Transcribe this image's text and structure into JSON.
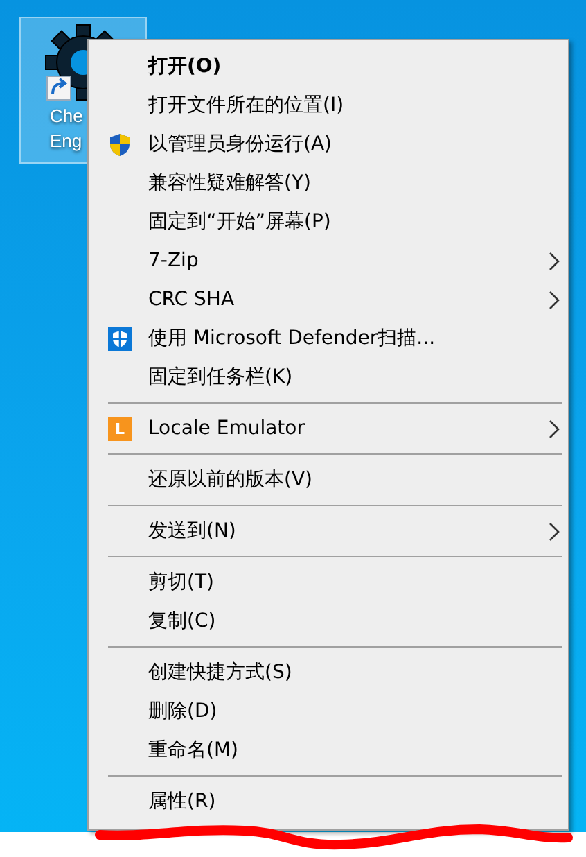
{
  "desktop_icon": {
    "label_lines": [
      "Che",
      "Eng"
    ],
    "selected": true
  },
  "context_menu": {
    "items": [
      {
        "kind": "item",
        "label": "打开(O)",
        "bold": true,
        "submenu": false
      },
      {
        "kind": "item",
        "label": "打开文件所在的位置(I)",
        "bold": false,
        "submenu": false
      },
      {
        "kind": "shield-item",
        "label": "以管理员身份运行(A)",
        "bold": false,
        "submenu": false
      },
      {
        "kind": "item",
        "label": "兼容性疑难解答(Y)",
        "bold": false,
        "submenu": false
      },
      {
        "kind": "item",
        "label": "固定到“开始”屏幕(P)",
        "bold": false,
        "submenu": false
      },
      {
        "kind": "item",
        "label": "7-Zip",
        "bold": false,
        "submenu": true
      },
      {
        "kind": "item",
        "label": "CRC SHA",
        "bold": false,
        "submenu": true
      },
      {
        "kind": "defender-item",
        "label": "使用 Microsoft Defender扫描...",
        "bold": false,
        "submenu": false
      },
      {
        "kind": "item",
        "label": "固定到任务栏(K)",
        "bold": false,
        "submenu": false
      },
      {
        "kind": "separator"
      },
      {
        "kind": "badge-item",
        "label": "Locale Emulator",
        "badge": "L",
        "bold": false,
        "submenu": true
      },
      {
        "kind": "separator"
      },
      {
        "kind": "item",
        "label": "还原以前的版本(V)",
        "bold": false,
        "submenu": false
      },
      {
        "kind": "separator"
      },
      {
        "kind": "item",
        "label": "发送到(N)",
        "bold": false,
        "submenu": true
      },
      {
        "kind": "separator"
      },
      {
        "kind": "item",
        "label": "剪切(T)",
        "bold": false,
        "submenu": false
      },
      {
        "kind": "item",
        "label": "复制(C)",
        "bold": false,
        "submenu": false
      },
      {
        "kind": "separator"
      },
      {
        "kind": "item",
        "label": "创建快捷方式(S)",
        "bold": false,
        "submenu": false
      },
      {
        "kind": "item",
        "label": "删除(D)",
        "bold": false,
        "submenu": false
      },
      {
        "kind": "item",
        "label": "重命名(M)",
        "bold": false,
        "submenu": false
      },
      {
        "kind": "separator"
      },
      {
        "kind": "item",
        "label": "属性(R)",
        "bold": false,
        "submenu": false
      }
    ]
  }
}
